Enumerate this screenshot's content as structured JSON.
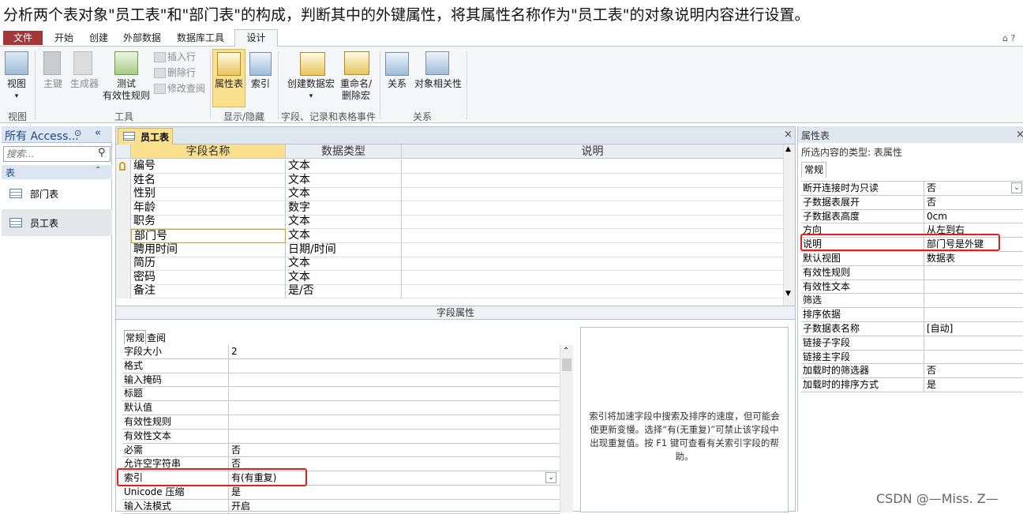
{
  "instruction": "分析两个表对象\"员工表\"和\"部门表\"的构成，判断其中的外键属性，将其属性名称作为\"员工表\"的对象说明内容进行设置。",
  "ribbon_tabs": [
    "文件",
    "开始",
    "创建",
    "外部数据",
    "数据库工具",
    "设计"
  ],
  "ribbon": {
    "view": "视图",
    "view_arrow": "▾",
    "primary_key": "主键",
    "builder": "生成器",
    "test_rules_1": "测试",
    "test_rules_2": "有效性规则",
    "insert_row": "插入行",
    "delete_row": "删除行",
    "modify_lookup": "修改查阅",
    "property_sheet": "属性表",
    "index": "索引",
    "create_macro": "创建数据宏",
    "rename_macro_1": "重命名/",
    "rename_macro_2": "删除宏",
    "relationships": "关系",
    "object_dependencies": "对象相关性",
    "group_views": "视图",
    "group_tools": "工具",
    "group_show_hide": "显示/隐藏",
    "group_events": "字段、记录和表格事件",
    "group_relationships": "关系"
  },
  "nav": {
    "header": "所有 Access...",
    "search_placeholder": "搜索...",
    "section": "表",
    "items": [
      "部门表",
      "员工表"
    ]
  },
  "doc": {
    "tab": "员工表",
    "close": "×",
    "columns": [
      "字段名称",
      "数据类型",
      "说明"
    ],
    "rows": [
      {
        "name": "编号",
        "type": "文本"
      },
      {
        "name": "姓名",
        "type": "文本"
      },
      {
        "name": "性别",
        "type": "文本"
      },
      {
        "name": "年龄",
        "type": "数字"
      },
      {
        "name": "职务",
        "type": "文本"
      },
      {
        "name": "部门号",
        "type": "文本"
      },
      {
        "name": "聘用时间",
        "type": "日期/时间"
      },
      {
        "name": "简历",
        "type": "文本"
      },
      {
        "name": "密码",
        "type": "文本"
      },
      {
        "name": "备注",
        "type": "是/否"
      }
    ],
    "field_props_title": "字段属性",
    "fp_tabs": [
      "常规",
      "查阅"
    ],
    "fp_rows": [
      {
        "k": "字段大小",
        "v": "2"
      },
      {
        "k": "格式",
        "v": ""
      },
      {
        "k": "输入掩码",
        "v": ""
      },
      {
        "k": "标题",
        "v": ""
      },
      {
        "k": "默认值",
        "v": ""
      },
      {
        "k": "有效性规则",
        "v": ""
      },
      {
        "k": "有效性文本",
        "v": ""
      },
      {
        "k": "必需",
        "v": "否"
      },
      {
        "k": "允许空字符串",
        "v": "否"
      },
      {
        "k": "索引",
        "v": "有(有重复)"
      },
      {
        "k": "Unicode 压缩",
        "v": "是"
      },
      {
        "k": "输入法模式",
        "v": "开启"
      }
    ],
    "help_text": "索引将加速字段中搜索及排序的速度，但可能会使更新变慢。选择“有(无重复)”可禁止该字段中出现重复值。按 F1 键可查看有关索引字段的帮助。"
  },
  "property_sheet": {
    "title": "属性表",
    "close": "×",
    "selection_type": "所选内容的类型: 表属性",
    "tab": "常规",
    "rows": [
      {
        "k": "断开连接时为只读",
        "v": "否"
      },
      {
        "k": "子数据表展开",
        "v": "否"
      },
      {
        "k": "子数据表高度",
        "v": "0cm"
      },
      {
        "k": "方向",
        "v": "从左到右"
      },
      {
        "k": "说明",
        "v": "部门号是外键"
      },
      {
        "k": "默认视图",
        "v": "数据表"
      },
      {
        "k": "有效性规则",
        "v": ""
      },
      {
        "k": "有效性文本",
        "v": ""
      },
      {
        "k": "筛选",
        "v": ""
      },
      {
        "k": "排序依据",
        "v": ""
      },
      {
        "k": "子数据表名称",
        "v": "[自动]"
      },
      {
        "k": "链接子字段",
        "v": ""
      },
      {
        "k": "链接主字段",
        "v": ""
      },
      {
        "k": "加载时的筛选器",
        "v": "否"
      },
      {
        "k": "加载时的排序方式",
        "v": "是"
      }
    ]
  },
  "window_controls": "⌂ ?",
  "watermark": "CSDN @—Miss. Z—",
  "colors": {
    "file_tab": "#a4373a",
    "highlight": "#e02020",
    "selected_header": "#fbe08d"
  }
}
